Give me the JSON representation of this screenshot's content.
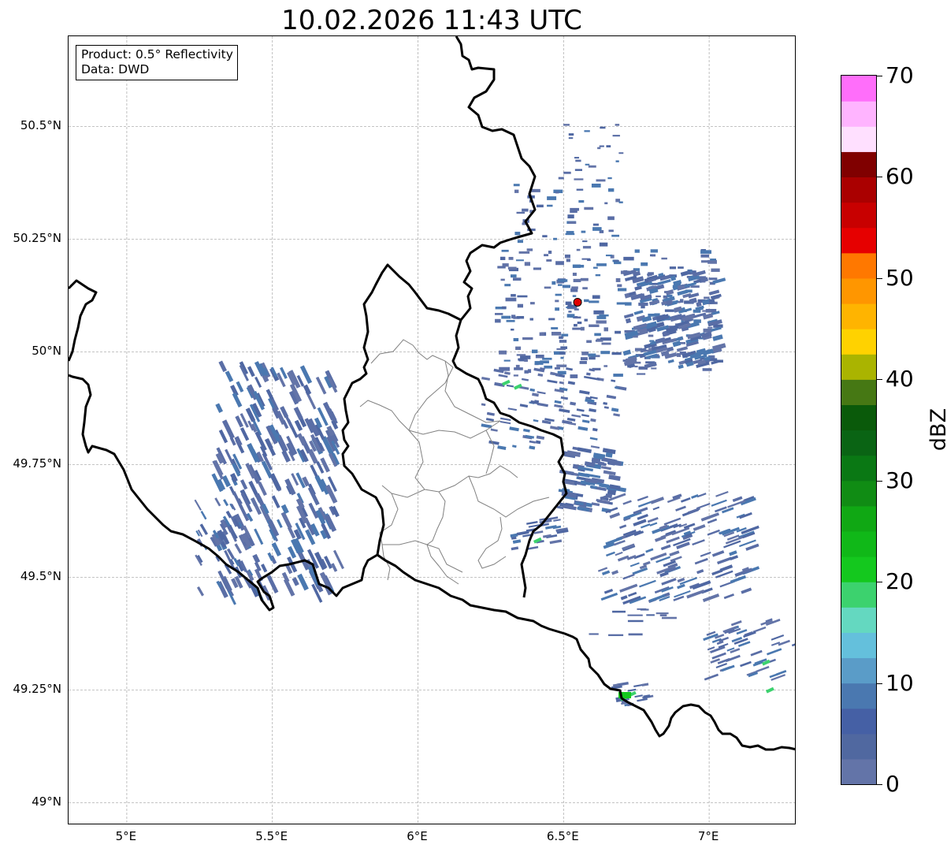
{
  "title": "10.02.2026 11:43 UTC",
  "info_box": {
    "line1": "Product: 0.5° Reflectivity",
    "line2": "Data: DWD"
  },
  "map": {
    "extent": {
      "lon_min": 4.8,
      "lon_max": 7.3,
      "lat_min": 48.95,
      "lat_max": 50.7
    },
    "lat_ticks": [
      {
        "value": 50.5,
        "label": "50.5°N"
      },
      {
        "value": 50.25,
        "label": "50.25°N"
      },
      {
        "value": 50.0,
        "label": "50°N"
      },
      {
        "value": 49.75,
        "label": "49.75°N"
      },
      {
        "value": 49.5,
        "label": "49.5°N"
      },
      {
        "value": 49.25,
        "label": "49.25°N"
      },
      {
        "value": 49.0,
        "label": "49°N"
      }
    ],
    "lon_ticks": [
      {
        "value": 5.0,
        "label": "5°E"
      },
      {
        "value": 5.5,
        "label": "5.5°E"
      },
      {
        "value": 6.0,
        "label": "6°E"
      },
      {
        "value": 6.5,
        "label": "6.5°E"
      },
      {
        "value": 7.0,
        "label": "7°E"
      }
    ],
    "gridlines": true,
    "radar_site": {
      "lon": 6.548,
      "lat": 50.11,
      "color": "#e00000"
    },
    "border_color": "#000000",
    "province_border_color": "#808080"
  },
  "colorbar": {
    "label": "dBZ",
    "min": 0,
    "max": 70,
    "step": 2.5,
    "ticks": [
      {
        "value": 0,
        "label": "0"
      },
      {
        "value": 10,
        "label": "10"
      },
      {
        "value": 20,
        "label": "20"
      },
      {
        "value": 30,
        "label": "30"
      },
      {
        "value": 40,
        "label": "40"
      },
      {
        "value": 50,
        "label": "50"
      },
      {
        "value": 60,
        "label": "60"
      },
      {
        "value": 70,
        "label": "70"
      }
    ],
    "colors": [
      "#6374a8",
      "#5068a0",
      "#4560a5",
      "#4a78b0",
      "#5a9cc8",
      "#64c0dc",
      "#64d8c0",
      "#3cd26e",
      "#14c81e",
      "#10b818",
      "#10a814",
      "#108c14",
      "#0a7814",
      "#0a6414",
      "#0a5a0a",
      "#467814",
      "#aab400",
      "#ffd200",
      "#ffb400",
      "#ff9600",
      "#ff7800",
      "#e60000",
      "#c80000",
      "#aa0000",
      "#800000",
      "#ffe0ff",
      "#ffb4ff",
      "#ff6efa"
    ]
  }
}
